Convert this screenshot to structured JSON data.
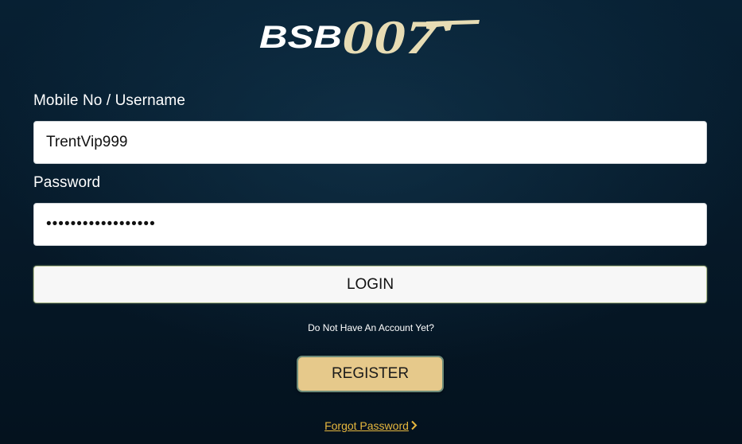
{
  "brand": {
    "logo_text_left": "BSB",
    "logo_text_right": "007",
    "colors": {
      "logo_white": "#ffffff",
      "logo_gold": "#e7dcb4"
    }
  },
  "form": {
    "username": {
      "label": "Mobile No / Username",
      "value": "TrentVip999"
    },
    "password": {
      "label": "Password",
      "value": "••••••••••••••••••"
    },
    "login_label": "LOGIN",
    "signup_prompt": "Do Not Have An Account Yet?",
    "register_label": "REGISTER",
    "forgot_label": "Forgot Password"
  },
  "icons": {
    "forgot_chevron": "chevron-right-icon"
  },
  "theme": {
    "background": "#061a2a",
    "register_bg": "#e6c98b",
    "link_color": "#e8b83e"
  }
}
